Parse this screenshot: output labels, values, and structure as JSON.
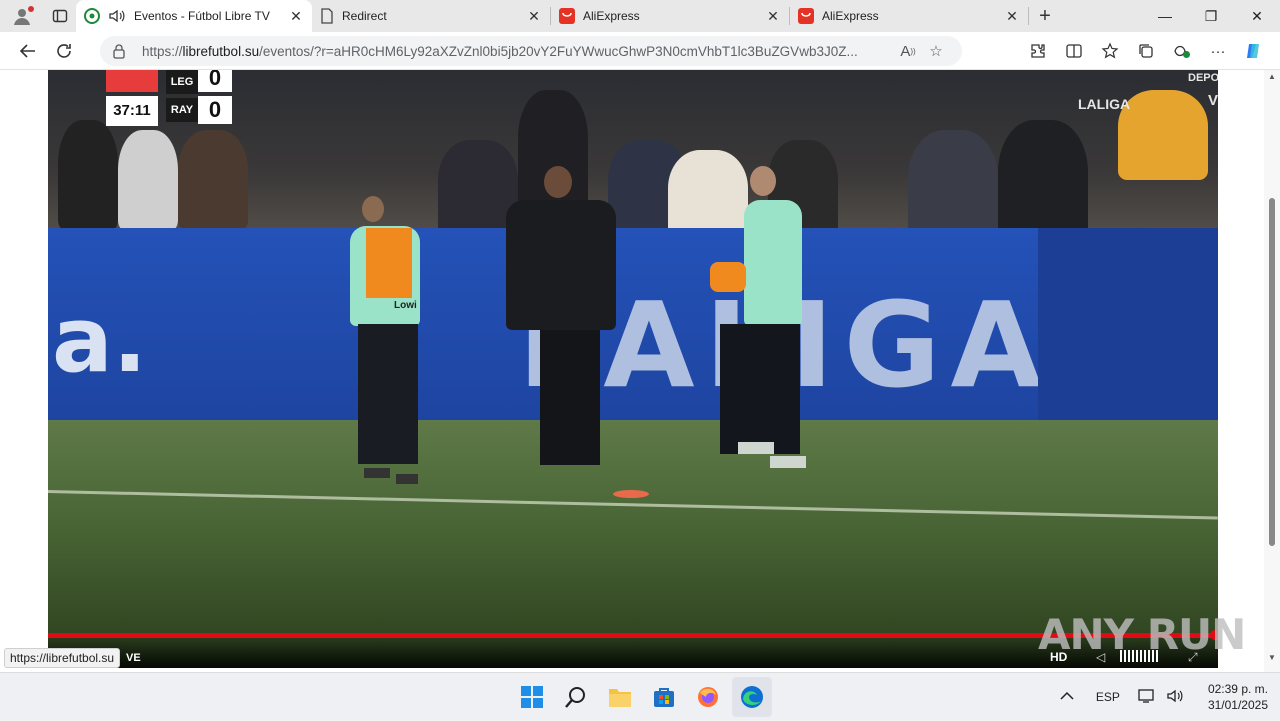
{
  "browser": {
    "tabs": [
      {
        "title": "Eventos - Fútbol Libre TV",
        "active": true,
        "audio": true
      },
      {
        "title": "Redirect",
        "active": false
      },
      {
        "title": "AliExpress",
        "active": false
      },
      {
        "title": "AliExpress",
        "active": false
      }
    ],
    "url_prefix": "https://",
    "url_domain": "librefutbol.su",
    "url_path": "/eventos/?r=aHR0cHM6Ly92aXZvZnl0bi5jb20vY2FuYWwucGhwP3N0cmVhbT1lc3BuZGVwb3J0Z..."
  },
  "video": {
    "scorebug": {
      "home": "LEG",
      "away": "RAY",
      "home_score": "0",
      "away_score": "0",
      "clock": "37:11"
    },
    "broadcaster": {
      "network": "DEPORTES",
      "league": "LALIGA",
      "live_label": "VIVO"
    },
    "board_text": "LALIGA",
    "board_left_text": "a.",
    "shirt_text": "Lowi",
    "controls": {
      "live_fragment": "VE",
      "hd_label": "HD",
      "progress": 1.0
    },
    "watermark": "ANY RUN"
  },
  "status_url": "https://librefutbol.su",
  "taskbar": {
    "language": "ESP",
    "time": "02:39 p. m.",
    "date": "31/01/2025"
  },
  "colors": {
    "progress": "#e50914",
    "board": "#2452b8",
    "aliexpress": "#e43225",
    "edge_blue": "#0c6fd1"
  }
}
